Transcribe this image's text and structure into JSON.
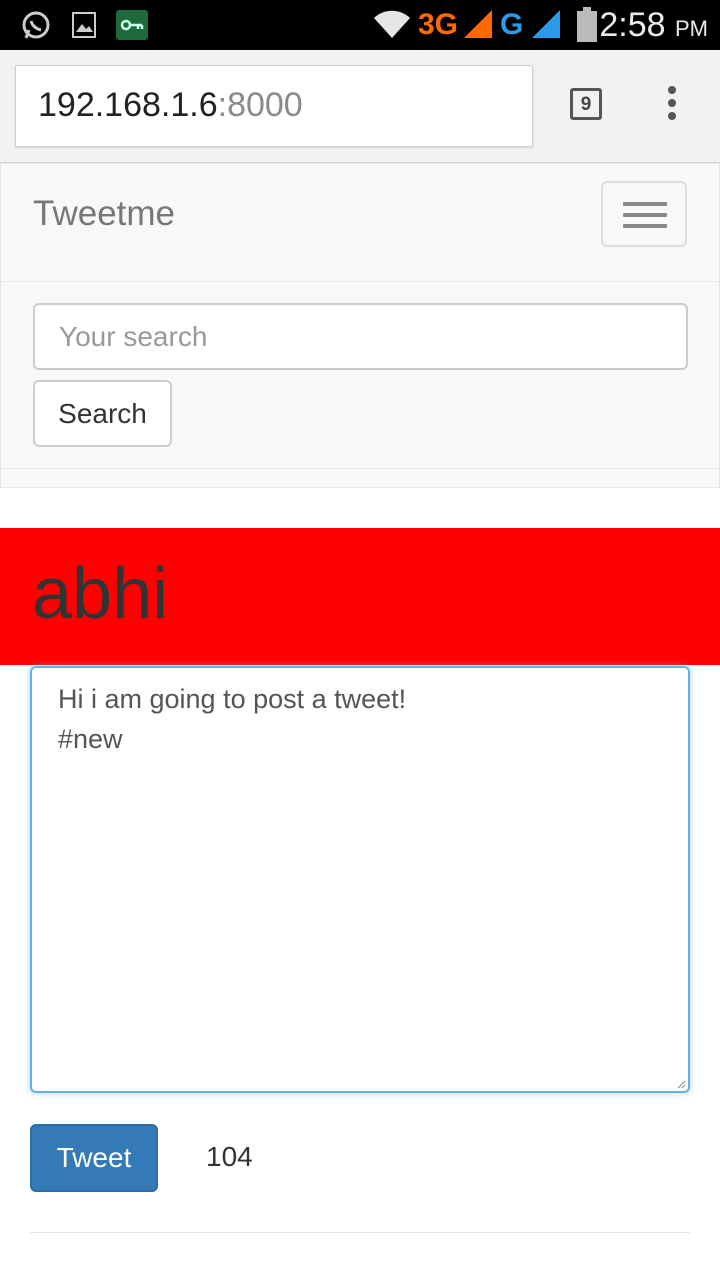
{
  "status_bar": {
    "time": "2:58",
    "ampm": "PM",
    "network_3g": "3G",
    "network_g": "G",
    "icons": [
      "whatsapp-icon",
      "gallery-icon",
      "vpn-key-icon",
      "wifi-icon",
      "signal-icon",
      "battery-icon"
    ],
    "colors": {
      "network_3g": "#ff6a00",
      "network_g": "#2a9be8"
    }
  },
  "browser": {
    "url_host": "192.168.1.6",
    "url_port": ":8000",
    "tab_count": "9",
    "icons": [
      "tab-switcher-icon",
      "overflow-menu-icon"
    ]
  },
  "navbar": {
    "brand": "Tweetme",
    "toggle_icon": "hamburger-icon",
    "search_placeholder": "Your search",
    "search_button": "Search"
  },
  "profile": {
    "username": "abhi",
    "banner_color": "#ff0000"
  },
  "composer": {
    "lines": [
      "Hi i am going to post a tweet!",
      "#new"
    ],
    "submit_label": "Tweet",
    "chars_remaining": "104",
    "accent": "#337ab7"
  }
}
